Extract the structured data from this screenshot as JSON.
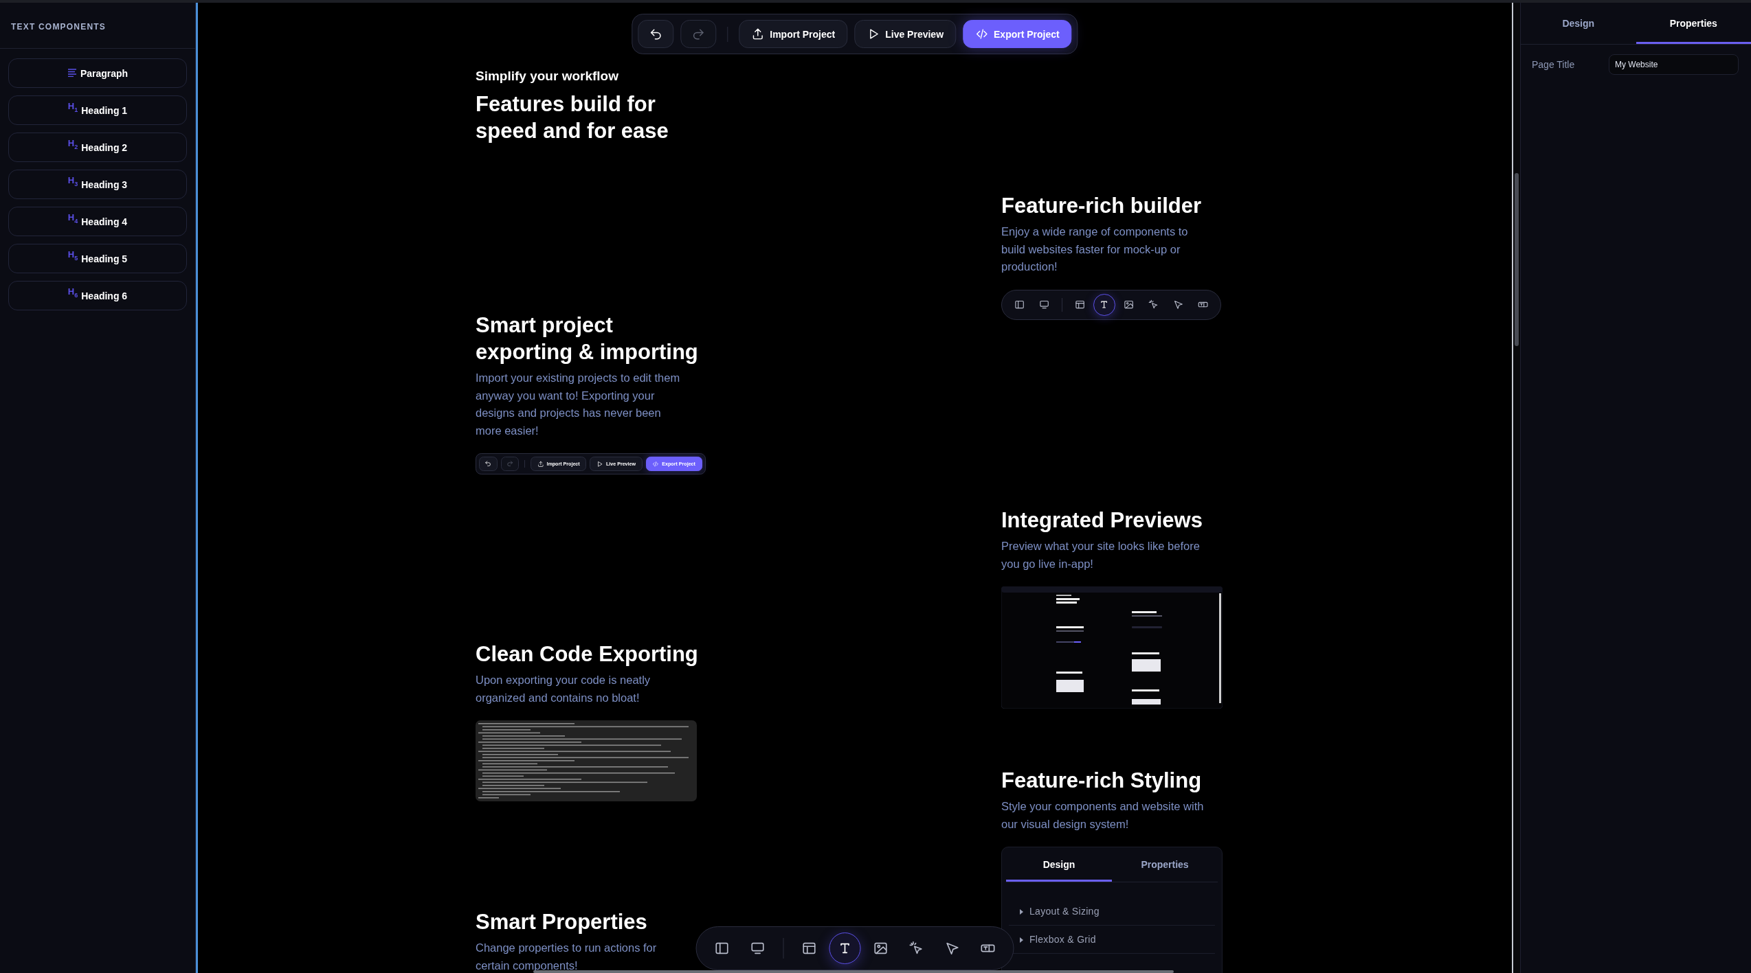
{
  "sidebar": {
    "title": "TEXT COMPONENTS",
    "items": [
      {
        "kind": "paragraph",
        "label": "Paragraph"
      },
      {
        "kind": "heading",
        "icon": "H$_{1}$",
        "label": "Heading 1"
      },
      {
        "kind": "heading",
        "icon": "H$_{2}$",
        "label": "Heading 2"
      },
      {
        "kind": "heading",
        "icon": "H$_{3}$",
        "label": "Heading 3"
      },
      {
        "kind": "heading",
        "icon": "H$_{4}$",
        "label": "Heading 4"
      },
      {
        "kind": "heading",
        "icon": "H$_{5}$",
        "label": "Heading 5"
      },
      {
        "kind": "heading",
        "icon": "H$_{6}$",
        "label": "Heading 6"
      }
    ]
  },
  "toolbar": {
    "history": [
      {
        "kind": "undo",
        "disabled": false
      },
      {
        "kind": "redo",
        "disabled": true
      }
    ],
    "buttons": [
      {
        "kind": "import",
        "label": "Import Project",
        "primary": false
      },
      {
        "kind": "preview",
        "label": "Live Preview",
        "primary": false
      },
      {
        "kind": "export",
        "label": "Export Project",
        "primary": true
      }
    ]
  },
  "canvas": {
    "intro": {
      "eyebrow": "Simplify your workflow",
      "heading": "Features build for speed and for ease"
    },
    "left_column": [
      {
        "heading": "Smart project exporting & importing",
        "text": "Import your existing projects to edit them anyway you want to! Exporting your designs and projects has never been more easier!",
        "media": {
          "kind": "toolbar",
          "history": [
            {
              "kind": "undo",
              "disabled": false
            },
            {
              "kind": "redo",
              "disabled": true
            }
          ],
          "buttons": [
            {
              "kind": "import",
              "label": "Import Project",
              "primary": false
            },
            {
              "kind": "preview",
              "label": "Live Preview",
              "primary": false
            },
            {
              "kind": "export",
              "label": "Export Project",
              "primary": true
            }
          ]
        }
      },
      {
        "heading": "Clean Code Exporting",
        "text": "Upon exporting your code is neatly organized and contains no bloat!",
        "media": {
          "kind": "code"
        }
      },
      {
        "heading": "Smart Properties",
        "text": "Change properties to run actions for certain components!"
      }
    ],
    "right_column": [
      {
        "heading": "Feature-rich builder",
        "text": "Enjoy a wide range of components to build websites faster for mock-up or production!",
        "media": {
          "kind": "tools",
          "tool_groups": [
            [
              {
                "kind": "sidebar",
                "selected": false
              },
              {
                "kind": "monitor",
                "selected": false
              }
            ],
            [
              {
                "kind": "layout",
                "selected": false
              },
              {
                "kind": "text",
                "selected": true
              },
              {
                "kind": "image",
                "selected": false
              },
              {
                "kind": "click",
                "selected": false
              },
              {
                "kind": "pointer",
                "selected": false
              },
              {
                "kind": "textbox",
                "selected": false
              }
            ]
          ]
        }
      },
      {
        "heading": "Integrated Previews",
        "text": "Preview what your site looks like before you go live in-app!",
        "media": {
          "kind": "preview"
        }
      },
      {
        "heading": "Feature-rich Styling",
        "text": "Style your components and website with our visual design system!",
        "media": {
          "kind": "style-panel",
          "tabs": [
            {
              "label": "Design",
              "selected": true
            },
            {
              "label": "Properties",
              "selected": false
            }
          ],
          "sections": [
            {
              "label": "Layout & Sizing",
              "expanded": false
            },
            {
              "label": "Flexbox & Grid",
              "expanded": false
            }
          ]
        }
      }
    ]
  },
  "tool_dock": {
    "tool_groups": [
      [
        {
          "kind": "sidebar",
          "selected": false
        },
        {
          "kind": "monitor",
          "selected": false
        }
      ],
      [
        {
          "kind": "layout",
          "selected": false
        },
        {
          "kind": "text",
          "selected": true
        },
        {
          "kind": "image",
          "selected": false
        },
        {
          "kind": "click",
          "selected": false
        },
        {
          "kind": "pointer",
          "selected": false
        },
        {
          "kind": "textbox",
          "selected": false
        }
      ]
    ]
  },
  "inspector": {
    "tabs": [
      {
        "label": "Design",
        "selected": false
      },
      {
        "label": "Properties",
        "selected": true
      }
    ],
    "fields": [
      {
        "label": "Page Title",
        "value": "My Website"
      }
    ]
  }
}
